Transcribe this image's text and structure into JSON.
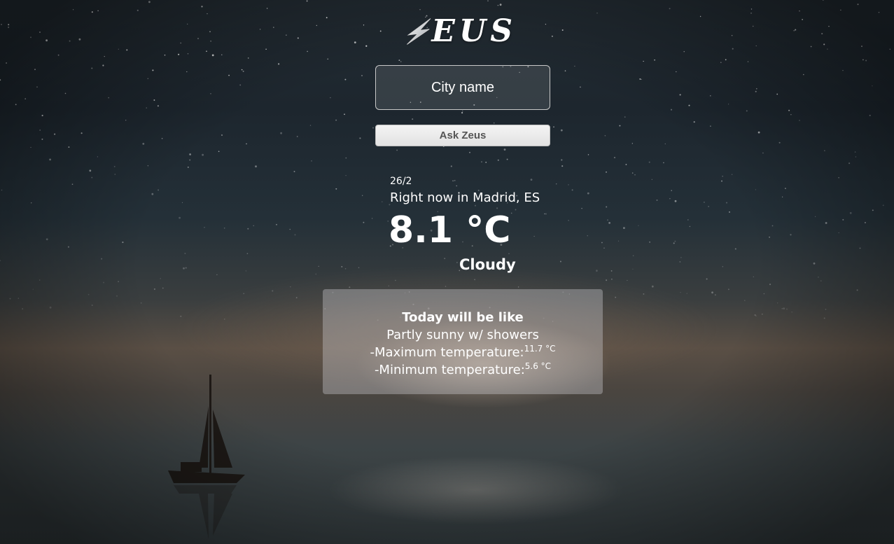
{
  "app": {
    "logo_text": "EUS"
  },
  "search": {
    "placeholder": "City name",
    "button_label": "Ask Zeus"
  },
  "current": {
    "date": "26/2",
    "location_text": "Right now in Madrid, ES",
    "temperature": "8.1 °C",
    "condition": "Cloudy"
  },
  "forecast": {
    "heading": "Today will be like",
    "summary": "Partly sunny w/ showers",
    "max_label": "-Maximum temperature:",
    "max_value": "11.7 °C",
    "min_label": "-Minimum temperature:",
    "min_value": "5.6 °C"
  },
  "icons": {
    "logo": "lightning-bolt-icon"
  },
  "colors": {
    "text": "#ffffff",
    "button_text": "#555555",
    "card_bg": "rgba(205,205,210,0.38)"
  }
}
